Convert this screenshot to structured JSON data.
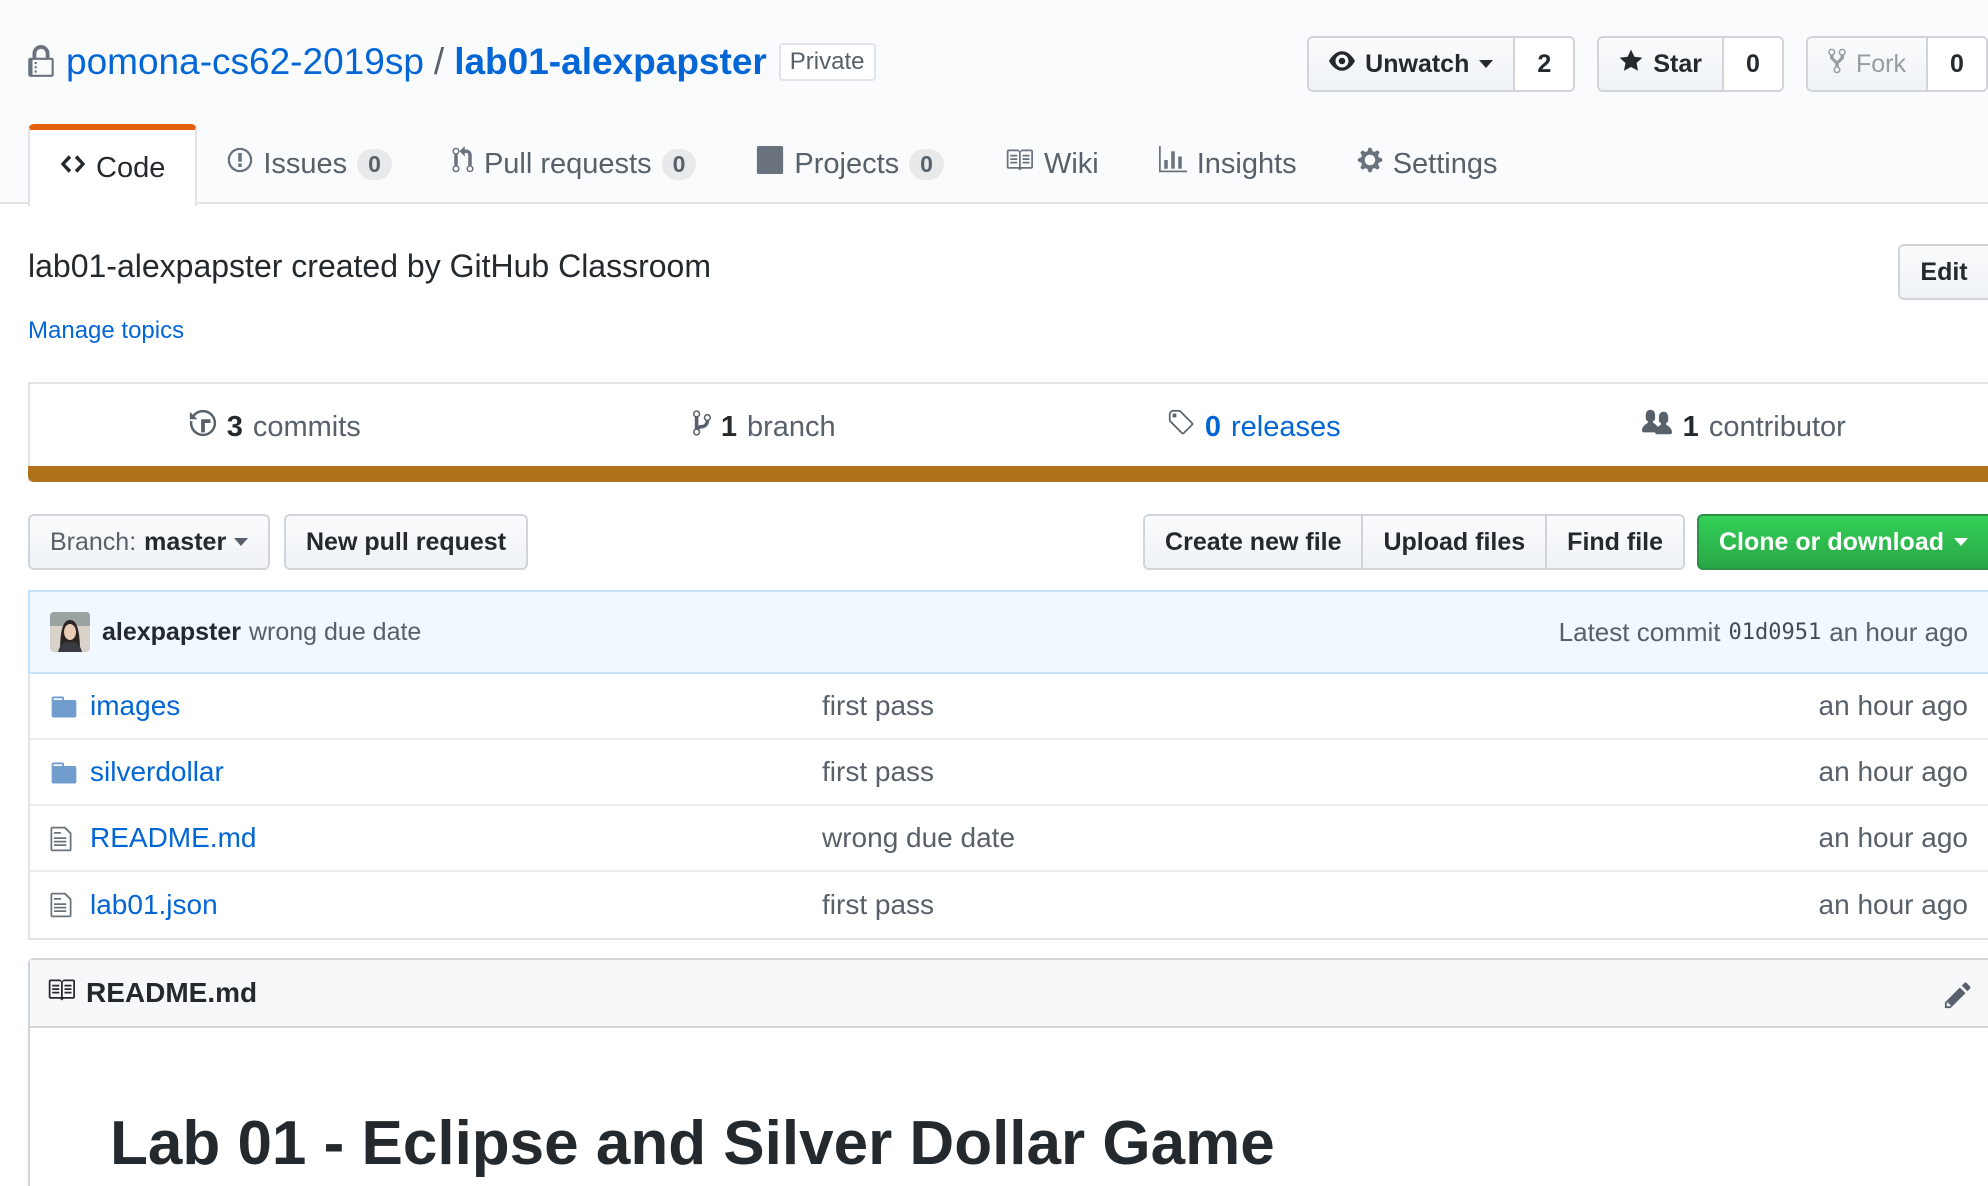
{
  "repo": {
    "owner": "pomona-cs62-2019sp",
    "separator": "/",
    "name": "lab01-alexpapster",
    "visibility": "Private"
  },
  "actions": {
    "watch_label": "Unwatch",
    "watch_count": "2",
    "star_label": "Star",
    "star_count": "0",
    "fork_label": "Fork",
    "fork_count": "0"
  },
  "tabs": [
    {
      "label": "Code",
      "icon": "code-icon"
    },
    {
      "label": "Issues",
      "count": "0",
      "icon": "issue-icon"
    },
    {
      "label": "Pull requests",
      "count": "0",
      "icon": "pull-request-icon"
    },
    {
      "label": "Projects",
      "count": "0",
      "icon": "project-icon"
    },
    {
      "label": "Wiki",
      "icon": "book-icon"
    },
    {
      "label": "Insights",
      "icon": "graph-icon"
    },
    {
      "label": "Settings",
      "icon": "gear-icon"
    }
  ],
  "description": "lab01-alexpapster created by GitHub Classroom",
  "edit_label": "Edit",
  "manage_topics": "Manage topics",
  "summary": {
    "commits_num": "3",
    "commits_label": "commits",
    "branches_num": "1",
    "branches_label": "branch",
    "releases_num": "0",
    "releases_label": "releases",
    "contributors_num": "1",
    "contributors_label": "contributor"
  },
  "colors": {
    "accent": "#0366d6",
    "language_bar": "#b07219",
    "tab_selected": "#e36209",
    "clone_green": "#28a745"
  },
  "file_nav": {
    "branch_prefix": "Branch:",
    "branch_name": "master",
    "new_pr": "New pull request",
    "create_file": "Create new file",
    "upload_files": "Upload files",
    "find_file": "Find file",
    "clone": "Clone or download"
  },
  "latest_commit": {
    "author": "alexpapster",
    "message": "wrong due date",
    "prefix": "Latest commit",
    "sha": "01d0951",
    "age": "an hour ago"
  },
  "files": [
    {
      "name": "images",
      "message": "first pass",
      "age": "an hour ago",
      "type": "folder"
    },
    {
      "name": "silverdollar",
      "message": "first pass",
      "age": "an hour ago",
      "type": "folder"
    },
    {
      "name": "README.md",
      "message": "wrong due date",
      "age": "an hour ago",
      "type": "file"
    },
    {
      "name": "lab01.json",
      "message": "first pass",
      "age": "an hour ago",
      "type": "file"
    }
  ],
  "readme": {
    "filename": "README.md",
    "heading": "Lab 01 - Eclipse and Silver Dollar Game"
  }
}
